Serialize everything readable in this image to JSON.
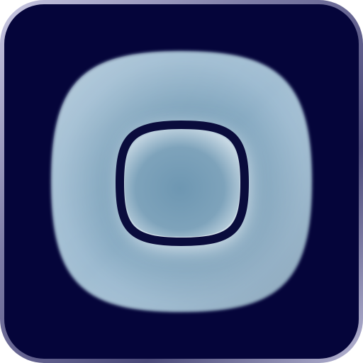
{
  "icon": {
    "name": "rounded-square-ring-app-icon",
    "colors": {
      "background": "#05053a",
      "bezel_light": "#b9b8d6",
      "bezel_dark": "#3a3968",
      "squircle_light": "#c5d9e6",
      "squircle_mid": "#a4c0d3",
      "squircle_dark": "#6f97b1",
      "inner_glow": "#e9f1f7",
      "ring_stroke": "#0a0c3c"
    }
  }
}
